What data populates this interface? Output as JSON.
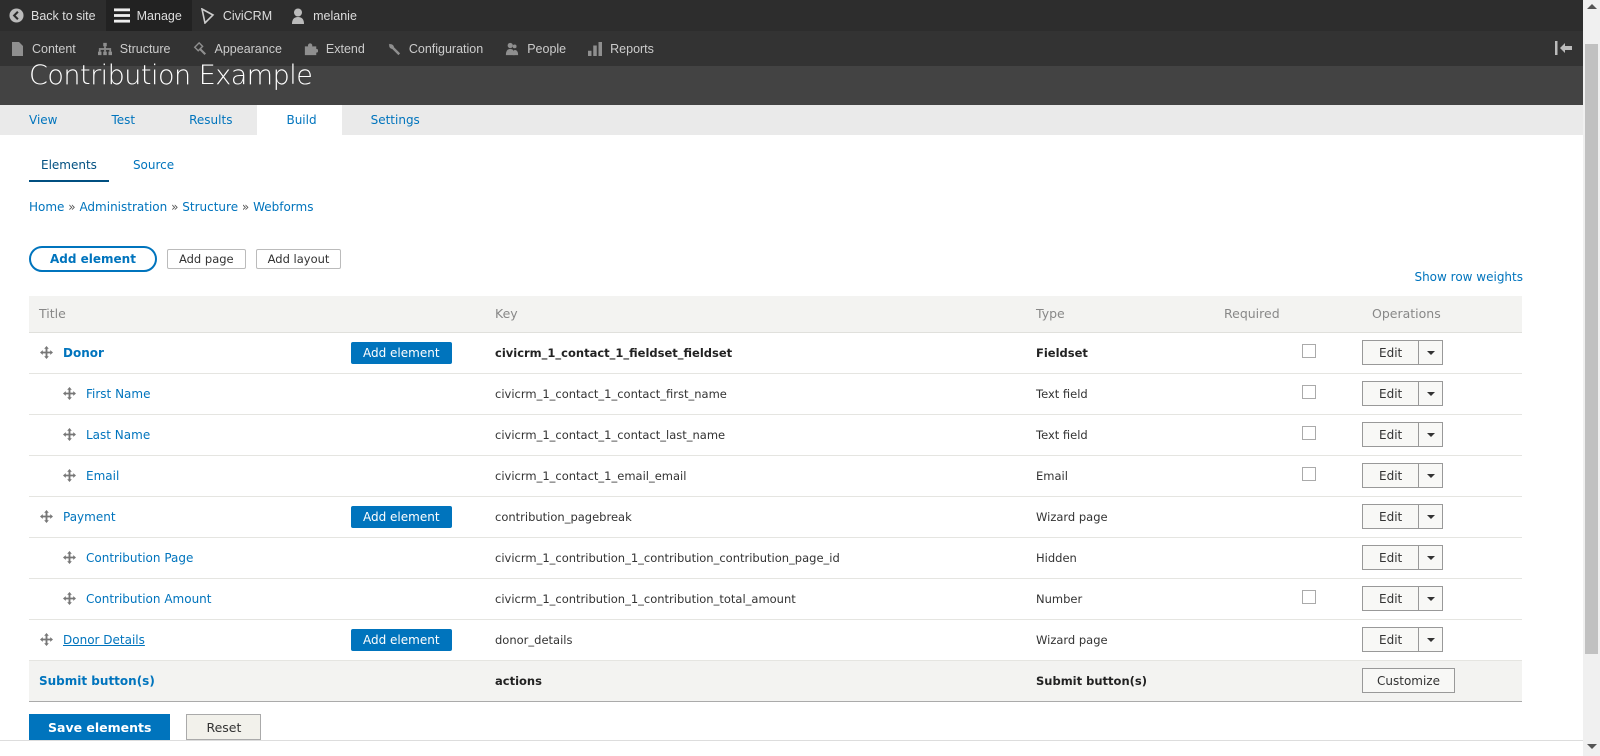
{
  "toolbar": {
    "items": [
      {
        "label": "Back to site",
        "icon": "back-circle-icon"
      },
      {
        "label": "Manage",
        "icon": "hamburger-icon"
      },
      {
        "label": "CiviCRM",
        "icon": "civicrm-icon"
      },
      {
        "label": "melanie",
        "icon": "user-icon"
      }
    ]
  },
  "admin_menu": {
    "items": [
      {
        "label": "Content",
        "icon": "file-icon"
      },
      {
        "label": "Structure",
        "icon": "sitemap-icon"
      },
      {
        "label": "Appearance",
        "icon": "paintbrush-icon"
      },
      {
        "label": "Extend",
        "icon": "puzzle-icon"
      },
      {
        "label": "Configuration",
        "icon": "wrench-icon"
      },
      {
        "label": "People",
        "icon": "people-icon"
      },
      {
        "label": "Reports",
        "icon": "bar-chart-icon"
      }
    ],
    "collapse_icon": "collapse-left-icon"
  },
  "header": {
    "title": "Contribution Example"
  },
  "tabs": [
    {
      "label": "View",
      "active": false
    },
    {
      "label": "Test",
      "active": false
    },
    {
      "label": "Results",
      "active": false
    },
    {
      "label": "Build",
      "active": true
    },
    {
      "label": "Settings",
      "active": false
    }
  ],
  "subtabs": [
    {
      "label": "Elements",
      "active": true
    },
    {
      "label": "Source",
      "active": false
    }
  ],
  "breadcrumb": [
    "Home",
    "Administration",
    "Structure",
    "Webforms"
  ],
  "breadcrumb_sep": "»",
  "actions": {
    "add_element": "Add element",
    "add_page": "Add page",
    "add_layout": "Add layout",
    "show_row_weights": "Show row weights"
  },
  "table": {
    "headers": [
      "Title",
      "Key",
      "Type",
      "Required",
      "Operations"
    ],
    "rows": [
      {
        "title": "Donor",
        "level": 0,
        "bold": true,
        "add_element": "Add element",
        "key": "civicrm_1_contact_1_fieldset_fieldset",
        "type": "Fieldset",
        "required": false,
        "has_checkbox": true,
        "op": "Edit"
      },
      {
        "title": "First Name",
        "level": 1,
        "key": "civicrm_1_contact_1_contact_first_name",
        "type": "Text field",
        "required": false,
        "has_checkbox": true,
        "op": "Edit"
      },
      {
        "title": "Last Name",
        "level": 1,
        "key": "civicrm_1_contact_1_contact_last_name",
        "type": "Text field",
        "required": false,
        "has_checkbox": true,
        "op": "Edit"
      },
      {
        "title": "Email",
        "level": 1,
        "key": "civicrm_1_contact_1_email_email",
        "type": "Email",
        "required": false,
        "has_checkbox": true,
        "op": "Edit"
      },
      {
        "title": "Payment",
        "level": 0,
        "add_element": "Add element",
        "key": "contribution_pagebreak",
        "type": "Wizard page",
        "has_checkbox": false,
        "op": "Edit"
      },
      {
        "title": "Contribution Page",
        "level": 1,
        "key": "civicrm_1_contribution_1_contribution_contribution_page_id",
        "type": "Hidden",
        "has_checkbox": false,
        "op": "Edit"
      },
      {
        "title": "Contribution Amount",
        "level": 1,
        "key": "civicrm_1_contribution_1_contribution_total_amount",
        "type": "Number",
        "required": false,
        "has_checkbox": true,
        "op": "Edit"
      },
      {
        "title": "Donor Details",
        "level": 0,
        "underline": true,
        "add_element": "Add element",
        "key": "donor_details",
        "type": "Wizard page",
        "has_checkbox": false,
        "op": "Edit"
      }
    ],
    "footer": {
      "title": "Submit button(s)",
      "key": "actions",
      "type": "Submit button(s)",
      "op": "Customize"
    }
  },
  "bottom": {
    "save": "Save elements",
    "reset": "Reset"
  }
}
